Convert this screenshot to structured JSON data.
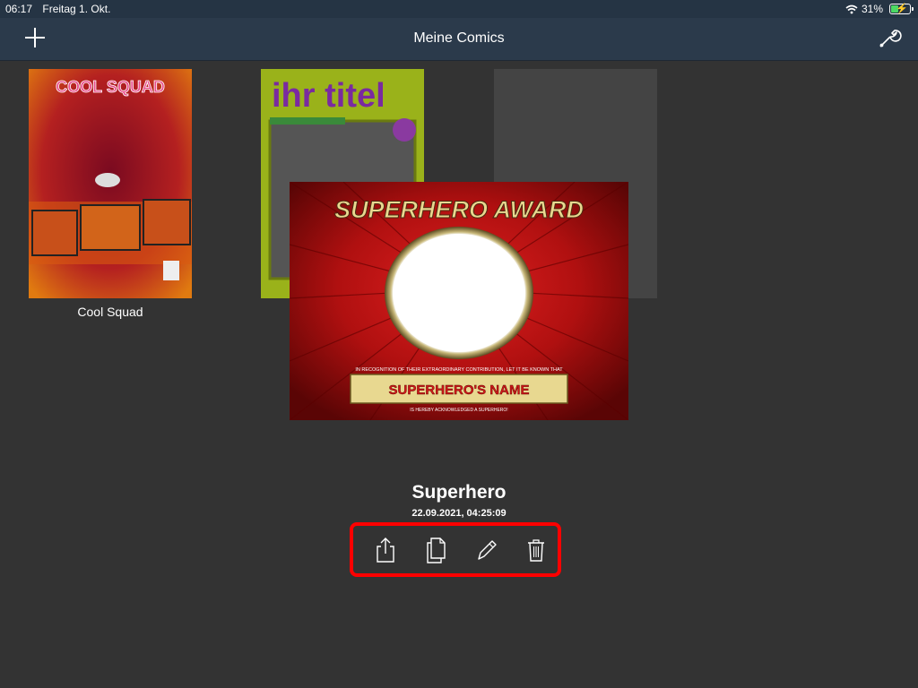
{
  "status": {
    "time": "06:17",
    "date": "Freitag 1. Okt.",
    "battery": "31%"
  },
  "nav": {
    "title": "Meine Comics",
    "add_icon": "plus-icon",
    "settings_icon": "wrench-icon"
  },
  "comics": [
    {
      "name": "Cool Squad",
      "cover_text": "COOL SQUAD"
    },
    {
      "name": "",
      "cover_text": "ihr titel"
    },
    {
      "name": "",
      "cover_text": ""
    }
  ],
  "selected": {
    "title": "Superhero",
    "timestamp": "22.09.2021, 04:25:09",
    "preview": {
      "heading": "SUPERHERO AWARD",
      "recognition": "IN RECOGNITION OF THEIR EXTRAORDINARY CONTRIBUTION, LET IT BE KNOWN THAT",
      "name": "SUPERHERO'S NAME",
      "footer": "IS HEREBY ACKNOWLEDGED A SUPERHERO!"
    }
  },
  "actions": [
    {
      "icon": "share-icon"
    },
    {
      "icon": "duplicate-icon"
    },
    {
      "icon": "edit-pencil-icon"
    },
    {
      "icon": "trash-icon"
    }
  ],
  "colors": {
    "background": "#333333",
    "navbar": "#2b3a4b",
    "highlight": "#ff0000",
    "award_red": "#b01010",
    "award_gold": "#e8d890"
  }
}
